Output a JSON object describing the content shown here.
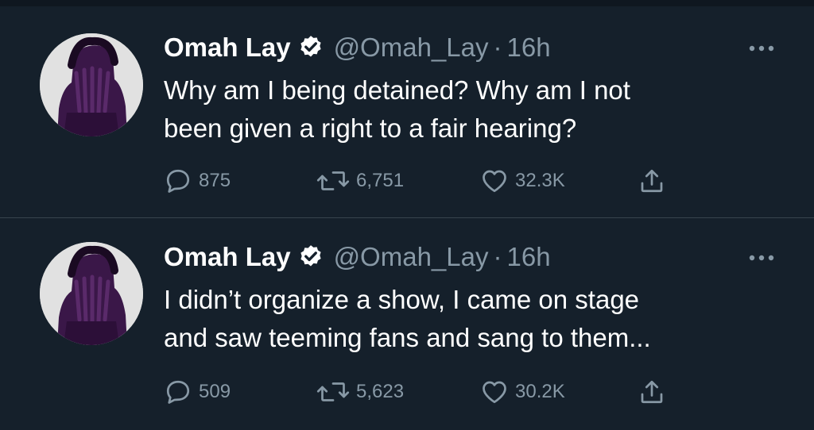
{
  "tweets": [
    {
      "author_name": "Omah Lay",
      "handle": "@Omah_Lay",
      "separator": "·",
      "time": "16h",
      "text_lines": [
        "Why am I being detained? Why am I not",
        "been given a right to a fair hearing?"
      ],
      "replies": "875",
      "retweets": "6,751",
      "likes": "32.3K",
      "icons": {
        "avatar": "avatar",
        "verified": "verified-badge-icon",
        "more": "more-options-icon",
        "reply": "reply-icon",
        "retweet": "retweet-icon",
        "like": "heart-icon",
        "share": "share-icon"
      }
    },
    {
      "author_name": "Omah Lay",
      "handle": "@Omah_Lay",
      "separator": "·",
      "time": "16h",
      "text_lines": [
        "I didn’t organize a show, I came on stage",
        "and saw teeming fans and sang to them..."
      ],
      "replies": "509",
      "retweets": "5,623",
      "likes": "30.2K",
      "icons": {
        "avatar": "avatar",
        "verified": "verified-badge-icon",
        "more": "more-options-icon",
        "reply": "reply-icon",
        "retweet": "retweet-icon",
        "like": "heart-icon",
        "share": "share-icon"
      }
    }
  ],
  "colors": {
    "background": "#15202b",
    "divider": "#38444d",
    "text_primary": "#ffffff",
    "text_secondary": "#8899a6",
    "avatar_bg": "#e1e1e1",
    "avatar_figure": "#3a1748"
  }
}
